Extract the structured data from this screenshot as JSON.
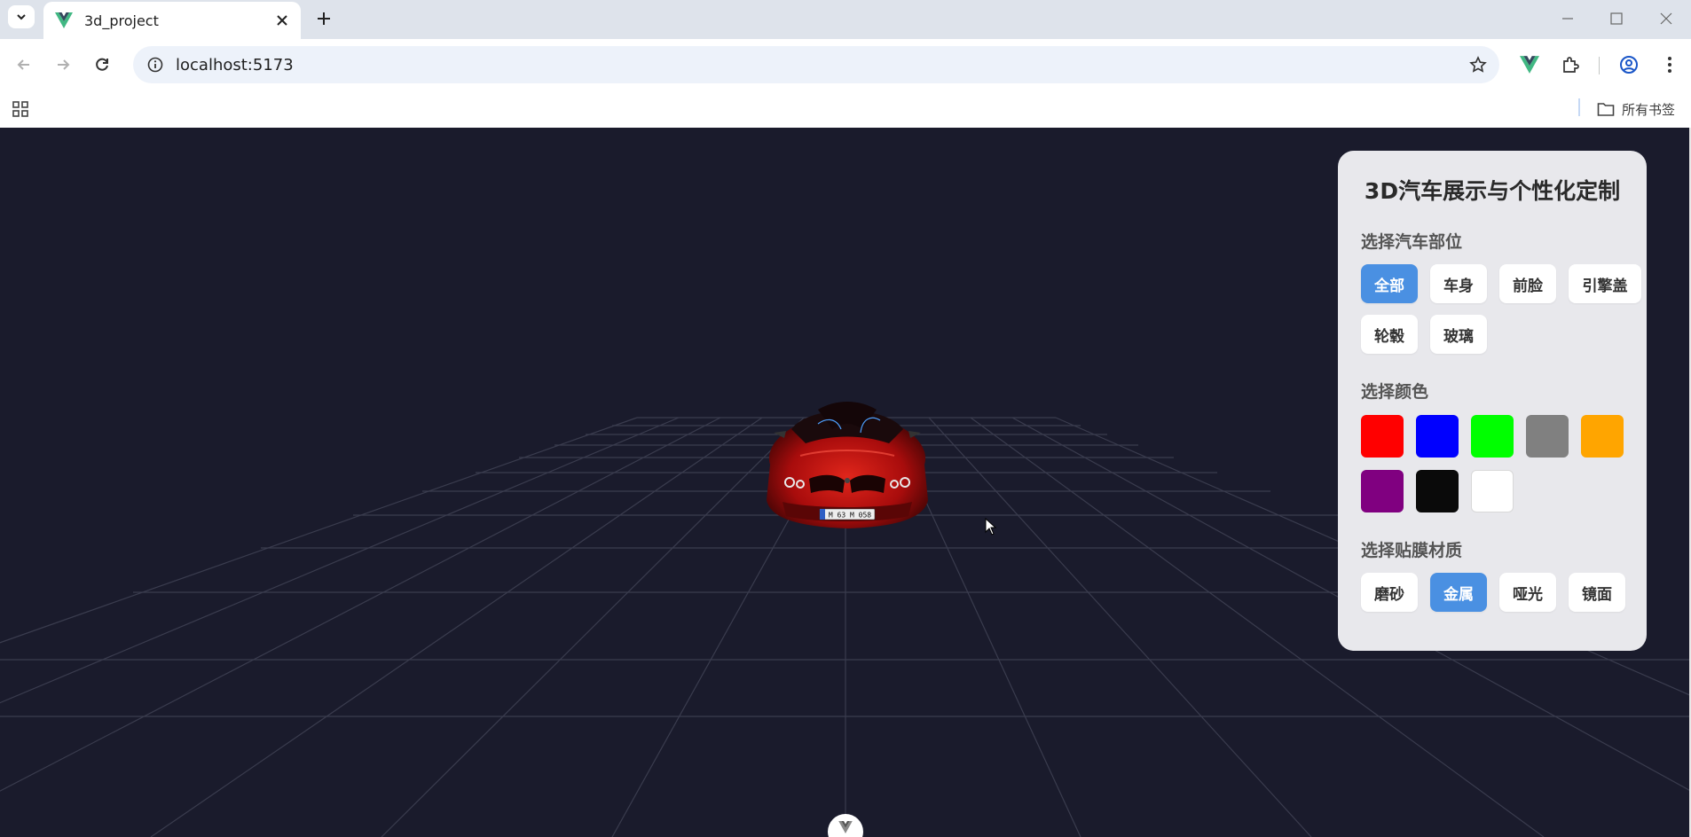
{
  "browser": {
    "tab_title": "3d_project",
    "url": "localhost:5173",
    "all_bookmarks_label": "所有书签"
  },
  "panel": {
    "title": "3D汽车展示与个性化定制",
    "parts_label": "选择汽车部位",
    "parts": [
      {
        "label": "全部",
        "active": true
      },
      {
        "label": "车身",
        "active": false
      },
      {
        "label": "前脸",
        "active": false
      },
      {
        "label": "引擎盖",
        "active": false
      },
      {
        "label": "轮毂",
        "active": false
      },
      {
        "label": "玻璃",
        "active": false
      }
    ],
    "color_label": "选择颜色",
    "colors": [
      "#ff0000",
      "#0000ff",
      "#00ff00",
      "#808080",
      "#ffa500",
      "#800080",
      "#0a0a0a",
      "#ffffff"
    ],
    "material_label": "选择贴膜材质",
    "materials": [
      {
        "label": "磨砂",
        "active": false
      },
      {
        "label": "金属",
        "active": true
      },
      {
        "label": "哑光",
        "active": false
      },
      {
        "label": "镜面",
        "active": false
      }
    ]
  },
  "car": {
    "plate": "M 63 M 058",
    "body_color": "#c40d0d"
  },
  "colors": {
    "accent": "#4a90e2",
    "scene_bg": "#1a1b2c",
    "grid": "#3a3c4e"
  }
}
